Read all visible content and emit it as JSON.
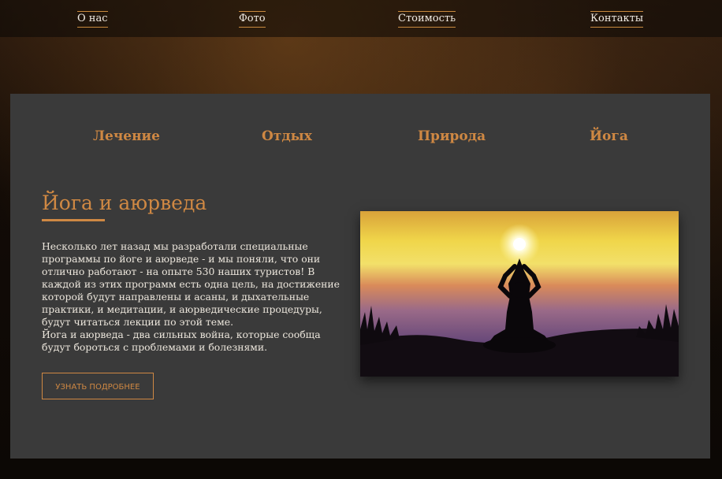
{
  "nav": {
    "items": [
      {
        "label": "О нас"
      },
      {
        "label": "Фото"
      },
      {
        "label": "Стоимость"
      },
      {
        "label": "Контакты"
      }
    ]
  },
  "categories": [
    {
      "label": "Лечение"
    },
    {
      "label": "Отдых"
    },
    {
      "label": "Природа"
    },
    {
      "label": "Йога"
    }
  ],
  "section": {
    "title": "Йога и аюрведа",
    "paragraphs": [
      "Несколько лет назад мы разработали специальные программы по йоге и аюрведе - и мы поняли, что они отлично работают - на опыте 530 наших туристов! В каждой из этих программ есть одна цель, на достижение которой будут направлены и асаны, и дыхательные практики, и медитации, и аюрведические процедуры, будут читаться лекции по этой теме.",
      "Йога и аюрведа - два сильных война, которые сообща будут бороться с проблемами и болезнями."
    ],
    "button_label": "УЗНАТЬ ПОДРОБНЕЕ"
  },
  "photo": {
    "icon": "yoga-sunset-photo"
  },
  "colors": {
    "accent": "#cf8843",
    "panel": "#3a3a3a",
    "nav_text": "#f2ece4"
  }
}
